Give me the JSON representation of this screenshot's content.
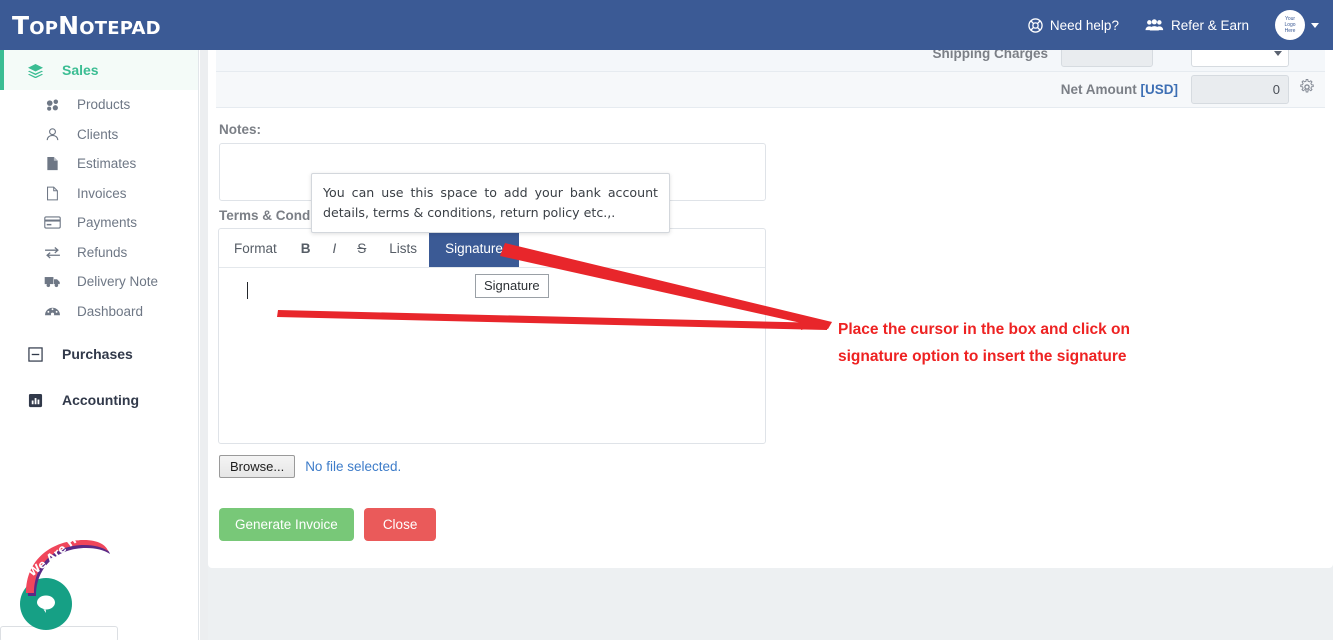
{
  "header": {
    "brand": "TopNotepad",
    "need_help": "Need help?",
    "refer_earn": "Refer & Earn",
    "avatar_line1": "Your",
    "avatar_line2": "Logo",
    "avatar_line3": "Here",
    "bg_color": "#3b5a95"
  },
  "sidebar": {
    "groups": [
      {
        "label": "Sales",
        "active": true,
        "icon": "layers-icon"
      },
      {
        "label": "Purchases",
        "active": false,
        "icon": "minus-square-icon"
      },
      {
        "label": "Accounting",
        "active": false,
        "icon": "bar-chart-icon"
      }
    ],
    "sales_items": [
      {
        "label": "Products",
        "icon": "cubes-icon"
      },
      {
        "label": "Clients",
        "icon": "user-icon"
      },
      {
        "label": "Estimates",
        "icon": "file-filled-icon"
      },
      {
        "label": "Invoices",
        "icon": "file-outline-icon"
      },
      {
        "label": "Payments",
        "icon": "credit-card-icon"
      },
      {
        "label": "Refunds",
        "icon": "exchange-icon"
      },
      {
        "label": "Delivery Note",
        "icon": "truck-icon"
      },
      {
        "label": "Dashboard",
        "icon": "dashboard-icon"
      }
    ],
    "active_color": "#3bbd93"
  },
  "totals": {
    "shipping_label": "Shipping Charges",
    "net_label": "Net Amount",
    "net_currency": "[USD]",
    "net_value": "0",
    "gear_icon": "gear-icon"
  },
  "form": {
    "notes_label": "Notes:",
    "notes_value": "",
    "terms_label": "Terms & Conditions:",
    "notes_tooltip": "You can use this space to add your bank account details, terms & conditions, return policy etc.,.",
    "signature_tooltip": "Signature"
  },
  "editor": {
    "toolbar": [
      {
        "label": "Format",
        "name": "format",
        "active": false
      },
      {
        "label": "B",
        "name": "bold",
        "active": false
      },
      {
        "label": "I",
        "name": "italic",
        "active": false
      },
      {
        "label": "S",
        "name": "strikethrough",
        "active": false
      },
      {
        "label": "Lists",
        "name": "lists",
        "active": false
      },
      {
        "label": "Signature",
        "name": "signature",
        "active": true
      }
    ],
    "format_label": "Format",
    "bold_label": "B",
    "italic_label": "I",
    "strike_label": "S",
    "lists_label": "Lists",
    "signature_label": "Signature",
    "content": "",
    "active_color": "#3b5a95"
  },
  "upload": {
    "browse_label": "Browse...",
    "file_status": "No file selected."
  },
  "actions": {
    "generate_label": "Generate Invoice",
    "close_label": "Close",
    "generate_color": "#78c878",
    "close_color": "#ea5a5a"
  },
  "annotation": {
    "line1": "Place the cursor in the box and click on",
    "line2": "signature option to insert the signature",
    "color": "#ee2222"
  },
  "chat": {
    "banner": "We Are Here!",
    "teaser": "",
    "icon": "chat-bubble-icon",
    "bubble_color": "#16a085",
    "banner_color": "#f0465b"
  }
}
